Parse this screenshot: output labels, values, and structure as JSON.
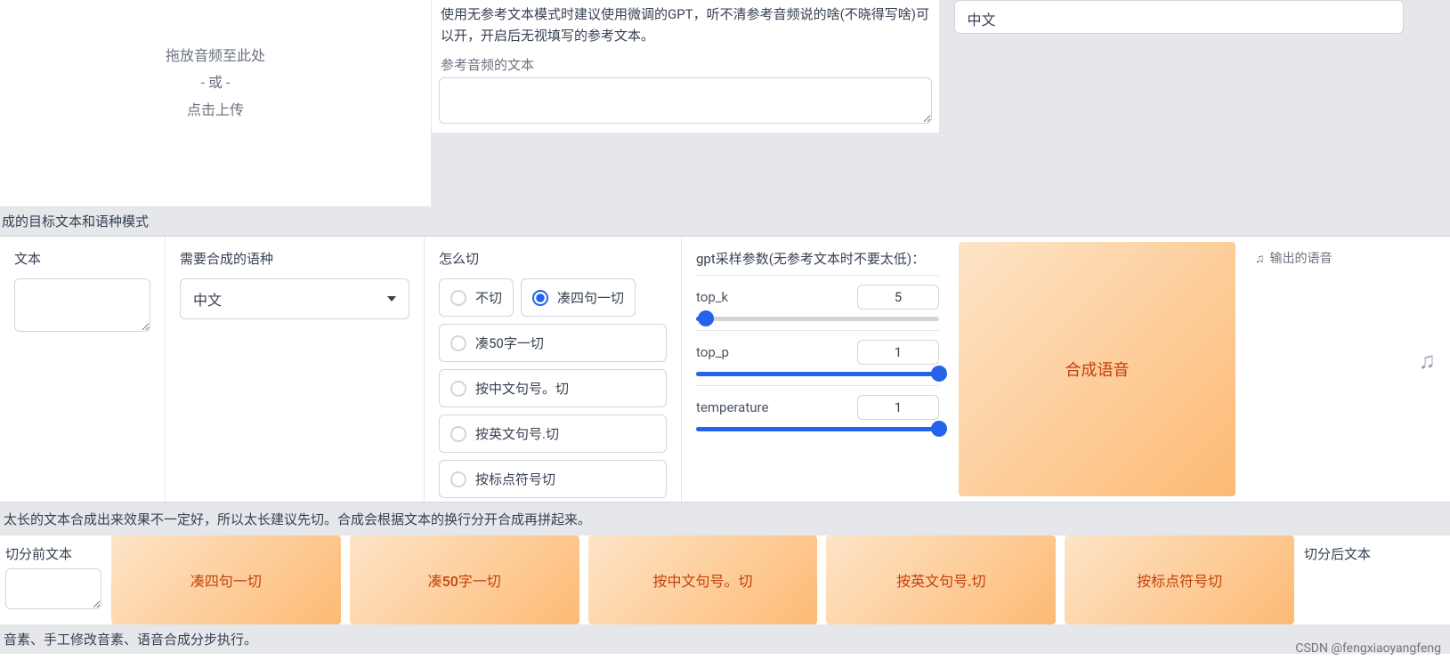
{
  "upload": {
    "line1": "拖放音频至此处",
    "line2": "- 或 -",
    "line3": "点击上传"
  },
  "ref": {
    "hint": "使用无参考文本模式时建议使用微调的GPT，听不清参考音频说的啥(不晓得写啥)可以开，开启后无视填写的参考文本。",
    "label": "参考音频的文本"
  },
  "top_lang": {
    "value": "中文"
  },
  "section1_title": "成的目标文本和语种模式",
  "target": {
    "label": "文本"
  },
  "synth_lang": {
    "label": "需要合成的语种",
    "value": "中文"
  },
  "cut": {
    "label": "怎么切",
    "options": [
      "不切",
      "凑四句一切",
      "凑50字一切",
      "按中文句号。切",
      "按英文句号.切",
      "按标点符号切"
    ],
    "selected": "凑四句一切"
  },
  "gpt": {
    "header": "gpt采样参数(无参考文本时不要太低)：",
    "top_k": {
      "label": "top_k",
      "value": "5",
      "fill_pct": 4
    },
    "top_p": {
      "label": "top_p",
      "value": "1",
      "fill_pct": 100
    },
    "temperature": {
      "label": "temperature",
      "value": "1",
      "fill_pct": 100
    }
  },
  "synth_button": "合成语音",
  "output": {
    "label": "输出的语音"
  },
  "hint_long": "太长的文本合成出来效果不一定好，所以太长建议先切。合成会根据文本的换行分开合成再拼起来。",
  "before_label": "切分前文本",
  "after_label": "切分后文本",
  "buttons": [
    "凑四句一切",
    "凑50字一切",
    "按中文句号。切",
    "按英文句号.切",
    "按标点符号切"
  ],
  "footer_hint": "音素、手工修改音素、语音合成分步执行。",
  "watermark": "CSDN @fengxiaoyangfeng"
}
